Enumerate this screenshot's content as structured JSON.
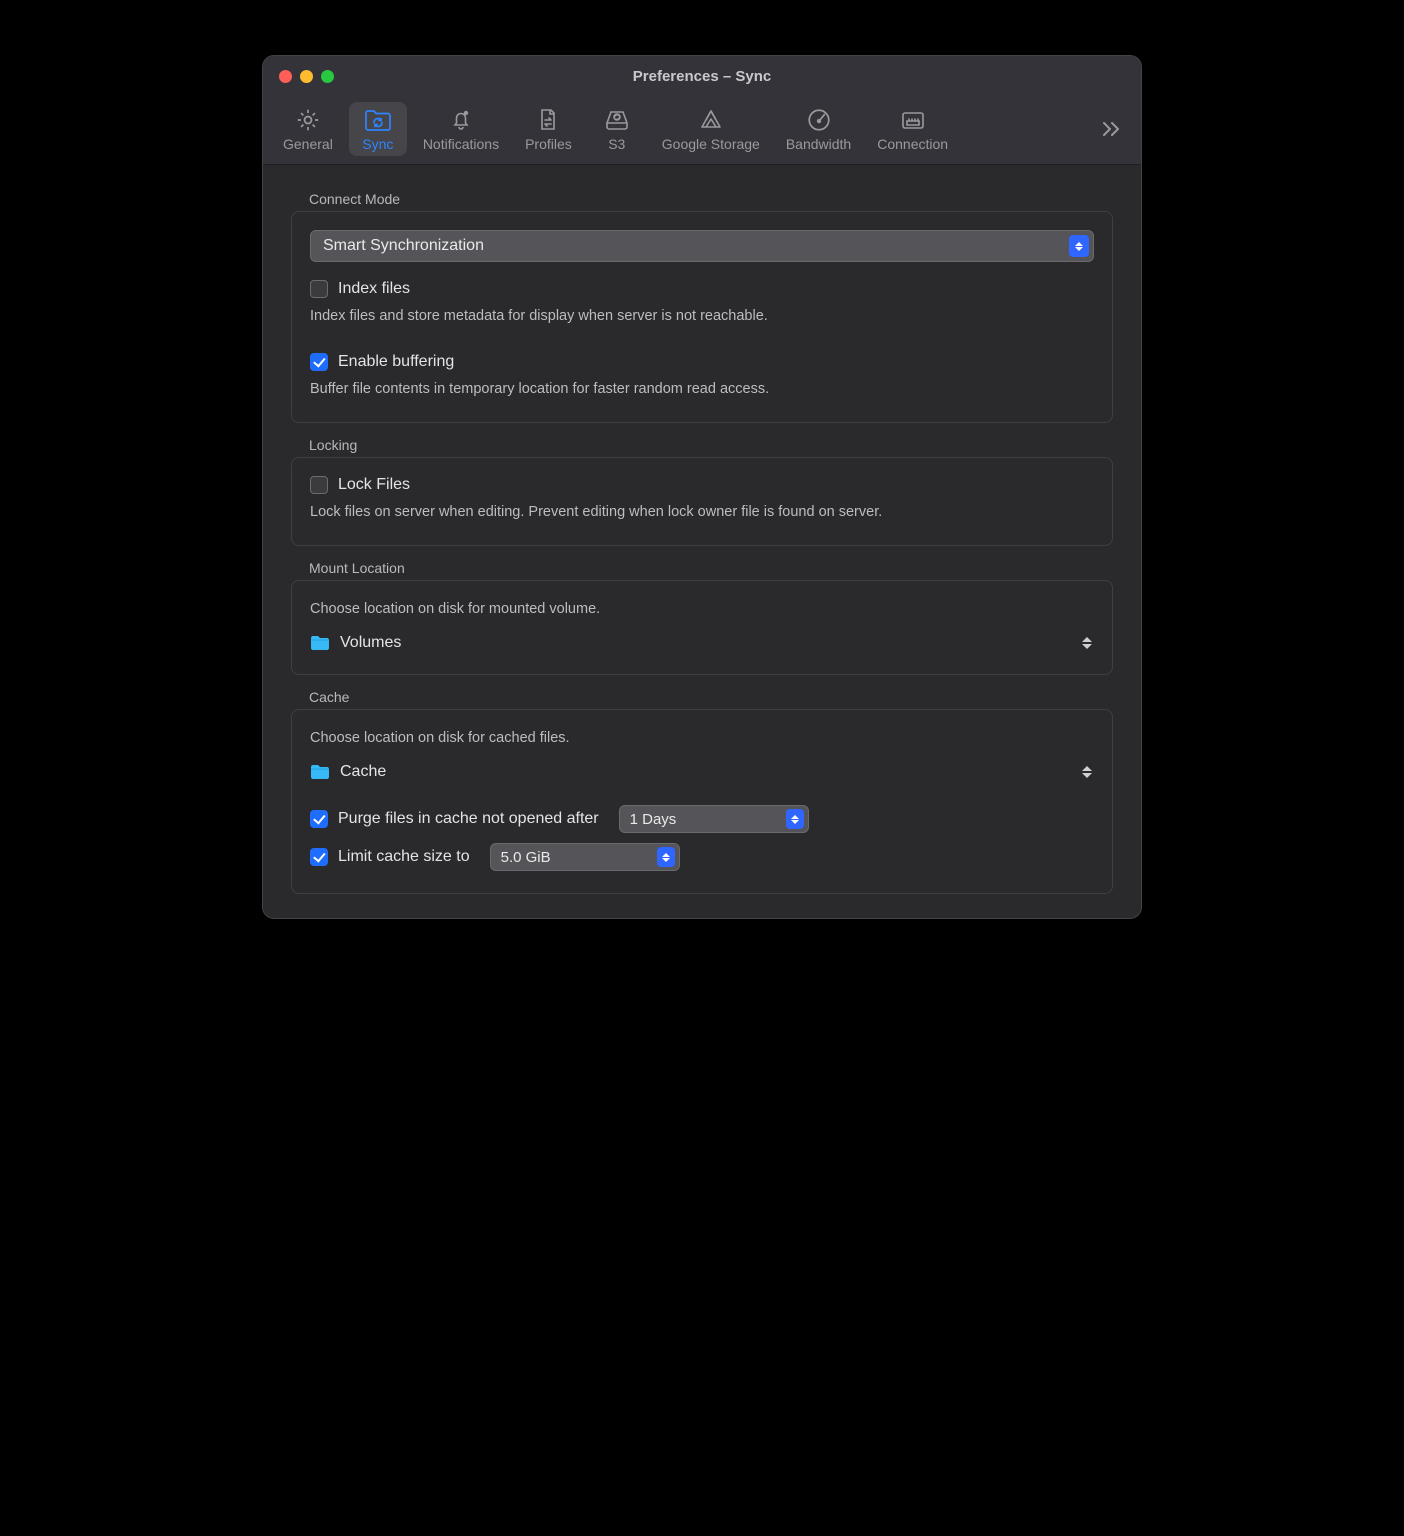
{
  "window": {
    "title": "Preferences – Sync"
  },
  "tabs": {
    "general": "General",
    "sync": "Sync",
    "notifications": "Notifications",
    "profiles": "Profiles",
    "s3": "S3",
    "google_storage": "Google Storage",
    "bandwidth": "Bandwidth",
    "connection": "Connection"
  },
  "sections": {
    "connect_mode": {
      "title": "Connect Mode",
      "selector_value": "Smart Synchronization",
      "index_label": "Index files",
      "index_desc": "Index files and store metadata for display when server is not reachable.",
      "buffer_label": "Enable buffering",
      "buffer_desc": "Buffer file contents in temporary location for faster random read access."
    },
    "locking": {
      "title": "Locking",
      "lock_label": "Lock Files",
      "lock_desc": "Lock files on server when editing. Prevent editing when lock owner file is found on server."
    },
    "mount": {
      "title": "Mount Location",
      "desc": "Choose location on disk for mounted volume.",
      "folder_name": "Volumes"
    },
    "cache": {
      "title": "Cache",
      "desc": "Choose location on disk for cached files.",
      "folder_name": "Cache",
      "purge_label": "Purge files in cache not opened after",
      "purge_value": "1 Days",
      "limit_label": "Limit cache size to",
      "limit_value": "5.0 GiB"
    }
  }
}
